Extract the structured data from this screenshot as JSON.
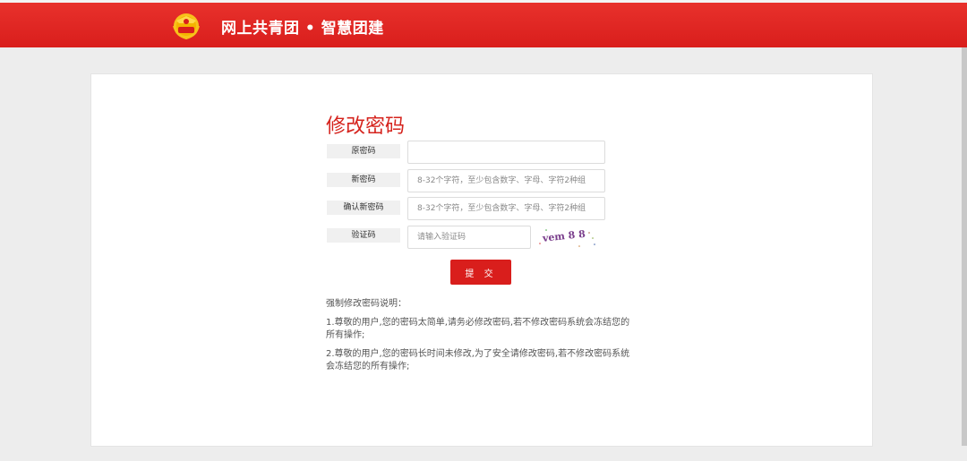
{
  "header": {
    "title": "网上共青团 • 智慧团建",
    "logo_icon": "communist-youth-league-emblem-icon"
  },
  "form": {
    "title": "修改密码",
    "fields": [
      {
        "label": "原密码",
        "value": "",
        "placeholder": ""
      },
      {
        "label": "新密码",
        "value": "",
        "placeholder": "8-32个字符，至少包含数字、字母、字符2种组"
      },
      {
        "label": "确认新密码",
        "value": "",
        "placeholder": "8-32个字符，至少包含数字、字母、字符2种组"
      },
      {
        "label": "验证码",
        "value": "",
        "placeholder": "请输入验证码"
      }
    ],
    "captcha_text": "vem 8 8",
    "submit_label": "提 交"
  },
  "notes": {
    "heading": "强制修改密码说明：",
    "items": [
      "1.尊敬的用户,您的密码太简单,请务必修改密码,若不修改密码系统会冻结您的所有操作;",
      "2.尊敬的用户,您的密码长时间未修改,为了安全请修改密码,若不修改密码系统会冻结您的所有操作;"
    ]
  },
  "colors": {
    "header_red": "#d91e1c",
    "title_red": "#d5231d",
    "button_red": "#d91e1c"
  }
}
